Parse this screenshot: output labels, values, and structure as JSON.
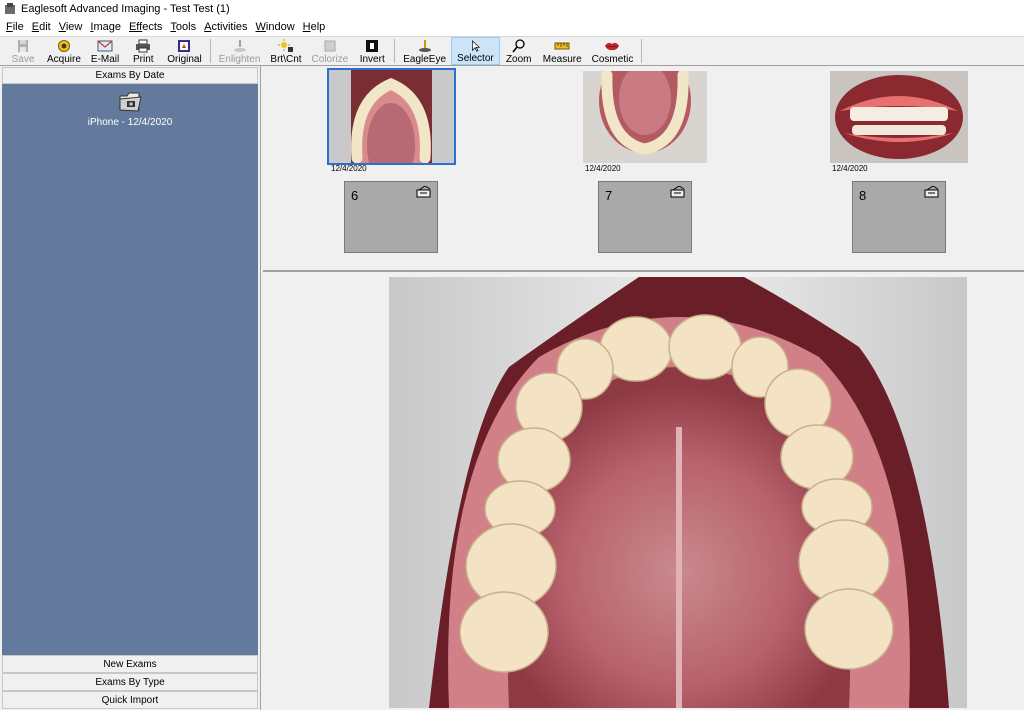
{
  "window": {
    "title": "Eaglesoft Advanced Imaging - Test Test (1)"
  },
  "menu": [
    {
      "label": "File",
      "key": "F",
      "rest": "ile"
    },
    {
      "label": "Edit",
      "key": "E",
      "rest": "dit"
    },
    {
      "label": "View",
      "key": "V",
      "rest": "iew"
    },
    {
      "label": "Image",
      "key": "I",
      "rest": "mage"
    },
    {
      "label": "Effects",
      "key": "Eff",
      "rest": "ects"
    },
    {
      "label": "Tools",
      "key": "T",
      "rest": "ools"
    },
    {
      "label": "Activities",
      "key": "A",
      "rest": "ctivities"
    },
    {
      "label": "Window",
      "key": "W",
      "rest": "indow"
    },
    {
      "label": "Help",
      "key": "H",
      "rest": "elp"
    }
  ],
  "toolbar": {
    "save": "Save",
    "acquire": "Acquire",
    "email": "E-Mail",
    "print": "Print",
    "original": "Original",
    "enlighten": "Enlighten",
    "brtcnt": "Brt\\Cnt",
    "colorize": "Colorize",
    "invert": "Invert",
    "eagleeye": "EagleEye",
    "selector": "Selector",
    "zoom": "Zoom",
    "measure": "Measure",
    "cosmetic": "Cosmetic"
  },
  "left_pane": {
    "header": "Exams By Date",
    "exam": {
      "label": "iPhone - 12/4/2020",
      "icon": "folder-camera-icon"
    },
    "tabs": {
      "new_exams": "New Exams",
      "by_type": "Exams By Type",
      "quick_import": "Quick Import"
    }
  },
  "thumbnails": [
    {
      "date": "12/4/2020",
      "view": "upper-occlusal",
      "selected": true
    },
    {
      "date": "12/4/2020",
      "view": "lower-occlusal",
      "selected": false
    },
    {
      "date": "12/4/2020",
      "view": "frontal",
      "selected": false
    }
  ],
  "slots": [
    {
      "number": "6"
    },
    {
      "number": "7"
    },
    {
      "number": "8"
    }
  ],
  "colors": {
    "exam_list_bg": "#637a9c",
    "selection": "#2a6fd1",
    "slot_bg": "#a9a9a9"
  }
}
